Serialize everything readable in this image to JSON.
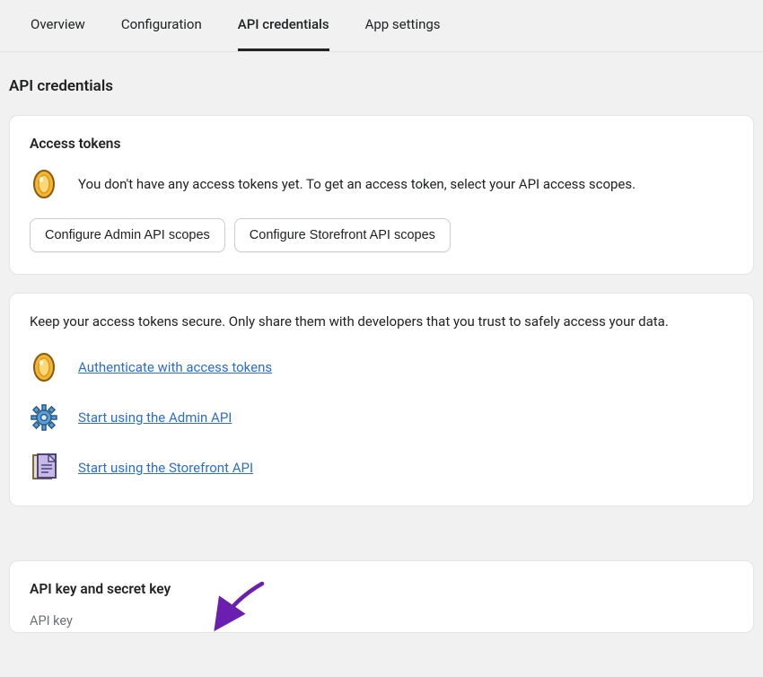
{
  "tabs": {
    "overview": "Overview",
    "configuration": "Configuration",
    "api_credentials": "API credentials",
    "app_settings": "App settings"
  },
  "page_title": "API credentials",
  "access_card": {
    "title": "Access tokens",
    "empty_text": "You don't have any access tokens yet. To get an access token, select your API access scopes.",
    "btn_admin": "Configure Admin API scopes",
    "btn_storefront": "Configure Storefront API scopes"
  },
  "secure_card": {
    "info": "Keep your access tokens secure. Only share them with developers that you trust to safely access your data.",
    "link_auth": "Authenticate with access tokens",
    "link_admin": "Start using the Admin API",
    "link_storefront": "Start using the Storefront API"
  },
  "keys_card": {
    "title": "API key and secret key",
    "api_key_label": "API key"
  }
}
